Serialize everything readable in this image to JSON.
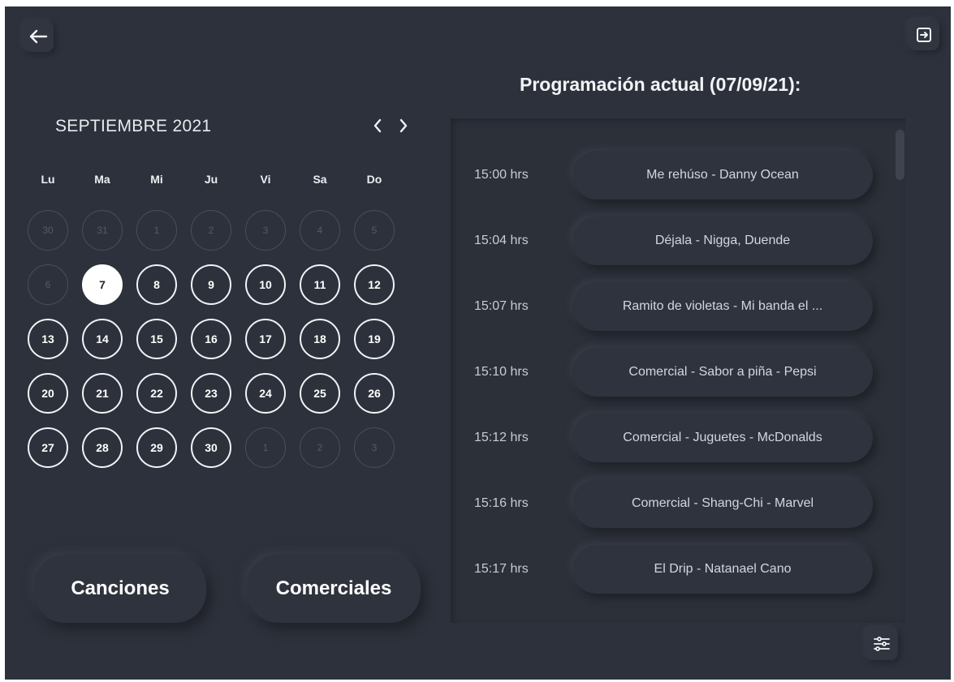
{
  "header": {
    "back_icon": "arrow-left-icon",
    "exit_icon": "logout-icon"
  },
  "calendar": {
    "month_label": "SEPTIEMBRE 2021",
    "prev_icon": "chevron-left-icon",
    "next_icon": "chevron-right-icon",
    "weekdays": [
      "Lu",
      "Ma",
      "Mi",
      "Ju",
      "Vi",
      "Sa",
      "Do"
    ],
    "weeks": [
      [
        {
          "d": "30",
          "state": "dim"
        },
        {
          "d": "31",
          "state": "dim"
        },
        {
          "d": "1",
          "state": "dim"
        },
        {
          "d": "2",
          "state": "dim"
        },
        {
          "d": "3",
          "state": "dim"
        },
        {
          "d": "4",
          "state": "dim"
        },
        {
          "d": "5",
          "state": "dim"
        }
      ],
      [
        {
          "d": "6",
          "state": "dim"
        },
        {
          "d": "7",
          "state": "selected"
        },
        {
          "d": "8",
          "state": "active"
        },
        {
          "d": "9",
          "state": "active"
        },
        {
          "d": "10",
          "state": "active"
        },
        {
          "d": "11",
          "state": "active"
        },
        {
          "d": "12",
          "state": "active"
        }
      ],
      [
        {
          "d": "13",
          "state": "active"
        },
        {
          "d": "14",
          "state": "active"
        },
        {
          "d": "15",
          "state": "active"
        },
        {
          "d": "16",
          "state": "active"
        },
        {
          "d": "17",
          "state": "active"
        },
        {
          "d": "18",
          "state": "active"
        },
        {
          "d": "19",
          "state": "active"
        }
      ],
      [
        {
          "d": "20",
          "state": "active"
        },
        {
          "d": "21",
          "state": "active"
        },
        {
          "d": "22",
          "state": "active"
        },
        {
          "d": "23",
          "state": "active"
        },
        {
          "d": "24",
          "state": "active"
        },
        {
          "d": "25",
          "state": "active"
        },
        {
          "d": "26",
          "state": "active"
        }
      ],
      [
        {
          "d": "27",
          "state": "active"
        },
        {
          "d": "28",
          "state": "active"
        },
        {
          "d": "29",
          "state": "active"
        },
        {
          "d": "30",
          "state": "active"
        },
        {
          "d": "1",
          "state": "dim"
        },
        {
          "d": "2",
          "state": "dim"
        },
        {
          "d": "3",
          "state": "dim"
        }
      ]
    ]
  },
  "buttons": {
    "songs_label": "Canciones",
    "ads_label": "Comerciales"
  },
  "schedule": {
    "title": "Programación actual (07/09/21):",
    "items": [
      {
        "time": "15:00 hrs",
        "label": "Me rehúso - Danny Ocean"
      },
      {
        "time": "15:04 hrs",
        "label": "Déjala - Nigga, Duende"
      },
      {
        "time": "15:07 hrs",
        "label": "Ramito de violetas - Mi banda el ..."
      },
      {
        "time": "15:10 hrs",
        "label": "Comercial - Sabor a piña - Pepsi"
      },
      {
        "time": "15:12 hrs",
        "label": "Comercial - Juguetes - McDonalds"
      },
      {
        "time": "15:16 hrs",
        "label": "Comercial - Shang-Chi - Marvel"
      },
      {
        "time": "15:17 hrs",
        "label": "El Drip - Natanael Cano"
      }
    ],
    "filter_icon": "sliders-icon"
  },
  "colors": {
    "background": "#2d313b",
    "text": "#e9ebf0",
    "selected_day": "#ffffff"
  }
}
